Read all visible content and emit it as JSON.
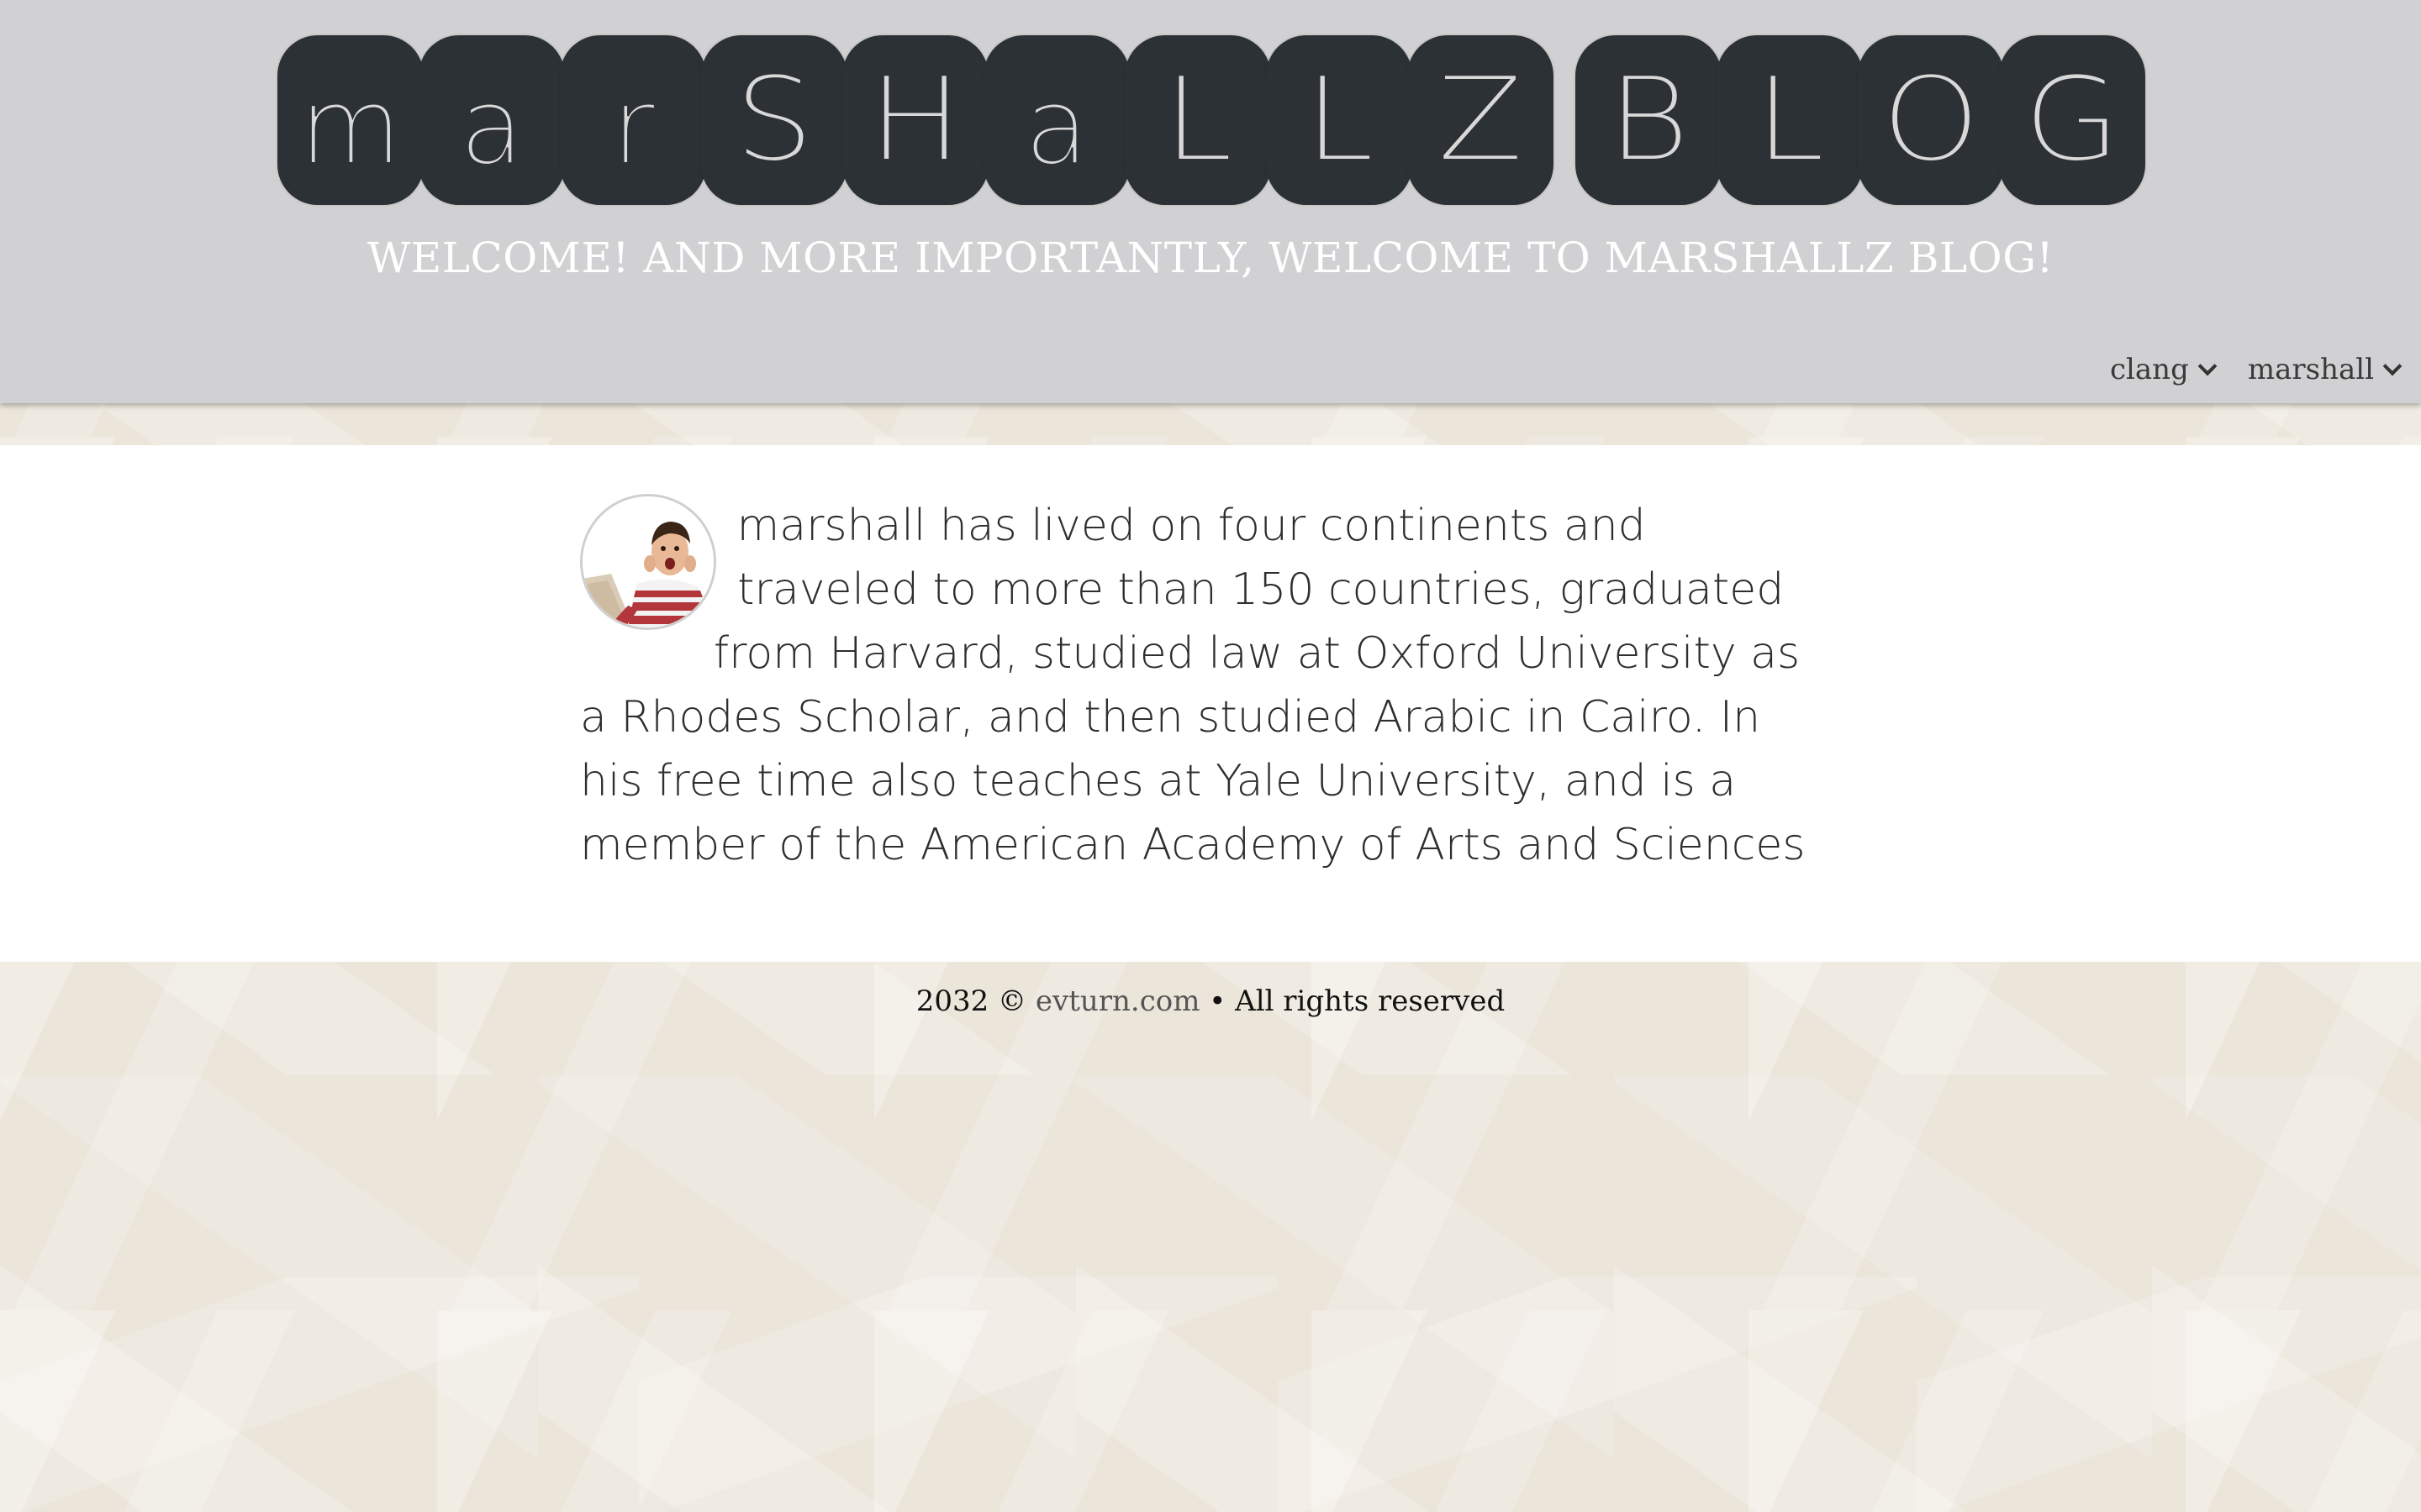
{
  "header": {
    "logo_word_1": [
      "m",
      "a",
      "r",
      "S",
      "H",
      "a",
      "L",
      "L",
      "Z"
    ],
    "logo_word_2": [
      "B",
      "L",
      "O",
      "G"
    ],
    "tagline": "WELCOME! AND MORE IMPORTANTLY, WELCOME TO MARSHALLZ BLOG!"
  },
  "nav": {
    "items": [
      {
        "label": "clang",
        "icon": "chevron-down-icon"
      },
      {
        "label": "marshall",
        "icon": "chevron-down-icon"
      }
    ]
  },
  "main": {
    "bio": "marshall has lived on four continents and traveled to more than 150 countries, graduated from Harvard, studied law at Oxford University as a Rhodes Scholar, and then studied Arabic in Cairo. In his free time also teaches at Yale University, and is a member of the American Academy of Arts and Sciences"
  },
  "footer": {
    "prefix": "2032 © ",
    "link_text": "evturn.com",
    "suffix": " • All rights reserved"
  },
  "colors": {
    "header_bg": "#d1d0d2",
    "logo_tile": "#2c3136",
    "logo_letter": "#d8d8d8",
    "page_bg": "#ebe5da",
    "content_bg": "#ffffff"
  }
}
